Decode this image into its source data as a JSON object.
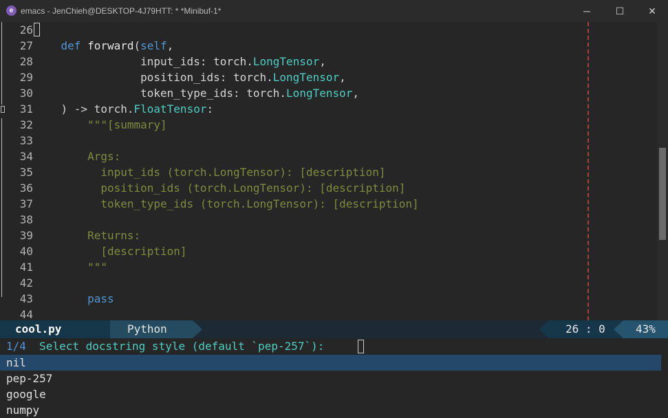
{
  "window": {
    "icon_glyph": "e",
    "title": "emacs - JenChieh@DESKTOP-4J79HTT:  * *Minibuf-1*",
    "minimize_glyph": "─",
    "maximize_glyph": "☐",
    "close_glyph": "✕"
  },
  "editor": {
    "lines": [
      {
        "n": "26",
        "parts": []
      },
      {
        "n": "27",
        "parts": [
          [
            "kw",
            "    def "
          ],
          [
            "fn",
            "forward"
          ],
          [
            "pn",
            "("
          ],
          [
            "kw",
            "self"
          ],
          [
            "pn",
            ","
          ]
        ]
      },
      {
        "n": "28",
        "parts": [
          [
            "pn",
            "                input_ids: torch."
          ],
          [
            "ty",
            "LongTensor"
          ],
          [
            "pn",
            ","
          ]
        ]
      },
      {
        "n": "29",
        "parts": [
          [
            "pn",
            "                position_ids: torch."
          ],
          [
            "ty",
            "LongTensor"
          ],
          [
            "pn",
            ","
          ]
        ]
      },
      {
        "n": "30",
        "parts": [
          [
            "pn",
            "                token_type_ids: torch."
          ],
          [
            "ty",
            "LongTensor"
          ],
          [
            "pn",
            ","
          ]
        ]
      },
      {
        "n": "31",
        "parts": [
          [
            "pn",
            "    ) -> torch."
          ],
          [
            "ty",
            "FloatTensor"
          ],
          [
            "pn",
            ":"
          ]
        ]
      },
      {
        "n": "32",
        "parts": [
          [
            "doc",
            "        \"\"\"[summary]"
          ]
        ]
      },
      {
        "n": "33",
        "parts": []
      },
      {
        "n": "34",
        "parts": [
          [
            "doc",
            "        Args:"
          ]
        ]
      },
      {
        "n": "35",
        "parts": [
          [
            "doc",
            "          input_ids (torch.LongTensor): [description]"
          ]
        ]
      },
      {
        "n": "36",
        "parts": [
          [
            "doc",
            "          position_ids (torch.LongTensor): [description]"
          ]
        ]
      },
      {
        "n": "37",
        "parts": [
          [
            "doc",
            "          token_type_ids (torch.LongTensor): [description]"
          ]
        ]
      },
      {
        "n": "38",
        "parts": []
      },
      {
        "n": "39",
        "parts": [
          [
            "doc",
            "        Returns:"
          ]
        ]
      },
      {
        "n": "40",
        "parts": [
          [
            "doc",
            "          [description]"
          ]
        ]
      },
      {
        "n": "41",
        "parts": [
          [
            "doc",
            "        \"\"\""
          ]
        ]
      },
      {
        "n": "42",
        "parts": []
      },
      {
        "n": "43",
        "parts": [
          [
            "kw",
            "        pass"
          ]
        ]
      },
      {
        "n": "44",
        "parts": []
      }
    ]
  },
  "modeline": {
    "filename": "cool.py",
    "mode": "Python",
    "position": "26 : 0",
    "percent": "43%"
  },
  "minibuffer": {
    "count": "1/4",
    "prompt": "  Select docstring style (default `pep-257`): ",
    "candidates": [
      "nil",
      "pep-257",
      "google",
      "numpy"
    ]
  },
  "colors": {
    "keyword": "#4f97d7",
    "type": "#4ecdc4",
    "docstring": "#7f8c3f",
    "selection": "#24486a"
  }
}
